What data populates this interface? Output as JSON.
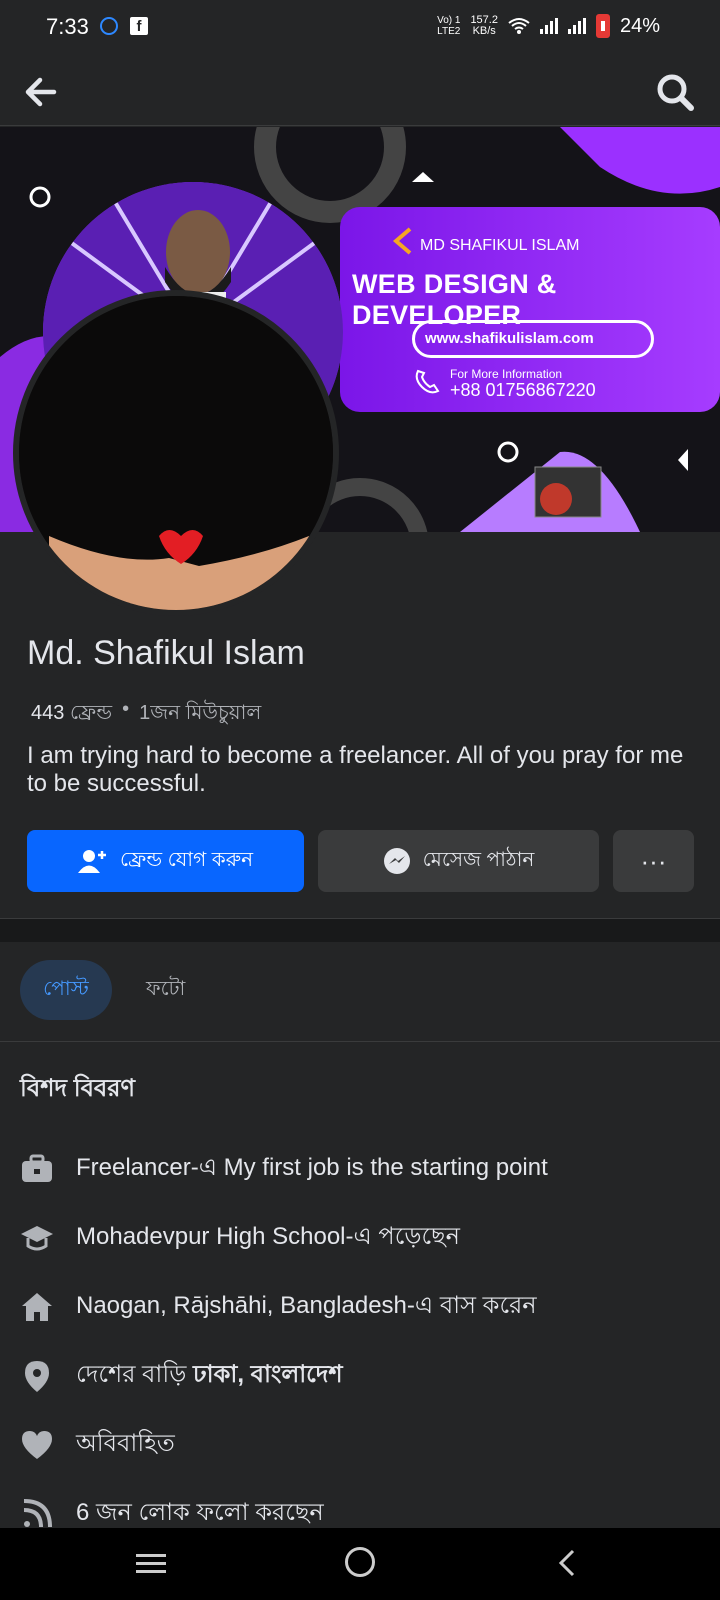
{
  "status_bar": {
    "time": "7:33",
    "network_top": "Vo) 1",
    "network_bottom": "LTE2",
    "speed_value": "157.2",
    "speed_unit": "KB/s",
    "battery": "24%"
  },
  "header": {
    "back_icon": "arrow-left-icon",
    "search_icon": "search-icon"
  },
  "cover": {
    "name": "MD SHAFIKUL ISLAM",
    "headline": "WEB DESIGN & DEVELOPER",
    "url": "www.shafikulislam.com",
    "info_label": "For More Information",
    "phone": "+88 01756867220",
    "accent_color": "#8b1cf7"
  },
  "profile": {
    "name": "Md. Shafikul Islam",
    "friends_count": "443",
    "friends_label": "ফ্রেন্ড",
    "mutual": "1জন মিউচুয়াল",
    "bio": "I am trying hard to become a freelancer. All of you pray for me to be successful."
  },
  "actions": {
    "add_friend": "ফ্রেন্ড যোগ করুন",
    "message": "মেসেজ পাঠান",
    "more": "···"
  },
  "tabs": {
    "posts": "পোস্ট",
    "photos": "ফটো"
  },
  "details": {
    "title": "বিশদ বিবরণ",
    "items": [
      {
        "icon": "briefcase-icon",
        "text": "Freelancer-এ My first job is the starting point"
      },
      {
        "icon": "graduation-cap-icon",
        "text": "Mohadevpur High School-এ পড়েছেন"
      },
      {
        "icon": "home-icon",
        "text": "Naogan, Rājshāhi, Bangladesh-এ বাস করেন"
      },
      {
        "icon": "location-pin-icon",
        "text_prefix": "দেশের বাড়ি ",
        "text_bold": "ঢাকা, বাংলাদেশ"
      },
      {
        "icon": "heart-icon",
        "text": "অবিবাহিত"
      },
      {
        "icon": "rss-icon",
        "text": "6 জন লোক ফলো করছেন"
      }
    ]
  }
}
